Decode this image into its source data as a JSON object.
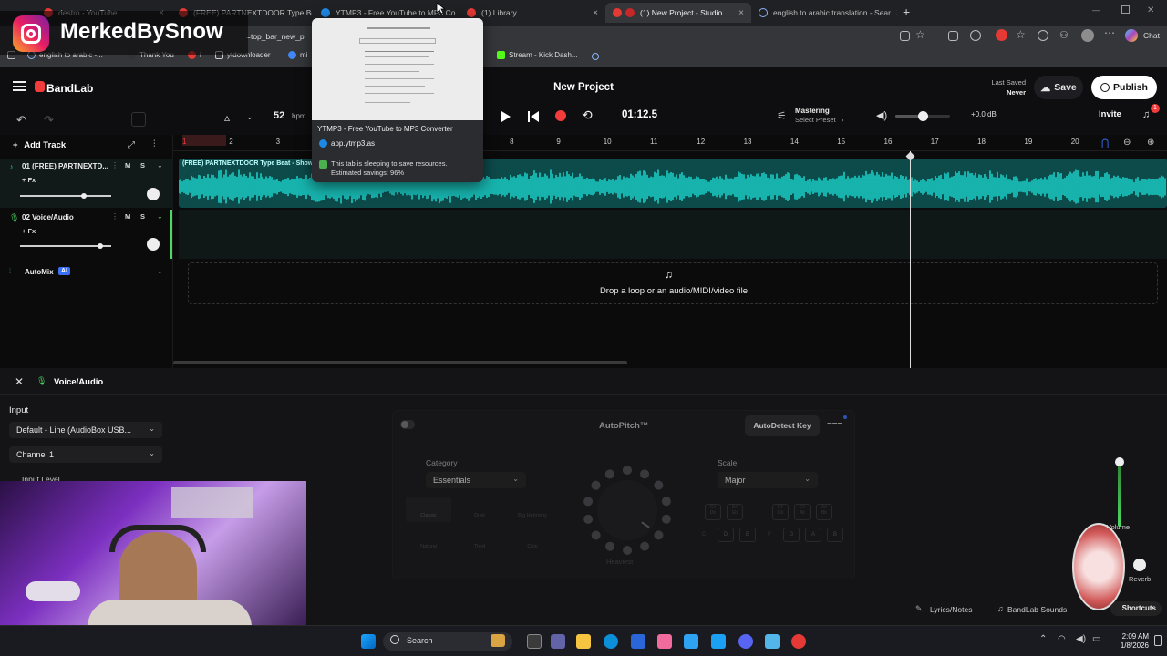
{
  "browser": {
    "tabs": [
      {
        "title": "destro - YouTube",
        "color": "#e53935"
      },
      {
        "title": "(FREE) PARTNEXTDOOR Type Beat",
        "color": "#e53935"
      },
      {
        "title": "YTMP3 - Free YouTube to MP3 Co",
        "color": "#1e88e5"
      },
      {
        "title": "(1) Library",
        "color": "#e53935"
      },
      {
        "title": "(1) New Project - Studio",
        "color": "#e53935"
      },
      {
        "title": "english to arabic translation - Sear",
        "color": "#8ab4f8"
      }
    ],
    "tab_close": "×",
    "new_tab": "+",
    "url": "=top_bar_new_p",
    "bookmarks": [
      "english to arabic -...",
      "Thank You",
      "i",
      "ytdownloader",
      "mi",
      "Stream - Kick Dash..."
    ],
    "chat_label": "Chat",
    "win_min": "—",
    "win_close": "✕"
  },
  "tab_preview": {
    "title": "YTMP3 - Free YouTube to MP3 Converter",
    "domain": "app.ytmp3.as",
    "sleep_line1": "This tab is sleeping to save resources.",
    "sleep_line2": "Estimated savings: 96%"
  },
  "watermark": {
    "name": "MerkedBySnow"
  },
  "app": {
    "brand": "BandLab",
    "project_title": "New Project",
    "last_saved_label": "Last Saved",
    "last_saved_value": "Never",
    "save_label": "Save",
    "publish_label": "Publish",
    "invite_label": "Invite",
    "notification_count": "1"
  },
  "transport": {
    "tempo": "52",
    "tempo_unit": "bpm",
    "time": "01:12.5",
    "mastering_label": "Mastering",
    "preset_label": "Select Preset",
    "preset_arrow": "›",
    "volume_db": "+0.0 dB",
    "volume_level": 0.5
  },
  "timeline": {
    "bars": [
      "1",
      "2",
      "3",
      "4",
      "5",
      "6",
      "7",
      "8",
      "9",
      "10",
      "11",
      "12",
      "13",
      "14",
      "15",
      "16",
      "17",
      "18",
      "19",
      "20"
    ],
    "playhead_bar": 16.55,
    "clip_label": "(FREE) PARTNEXTDOOR Type Beat - Show me",
    "drop_text": "Drop a loop or an audio/MIDI/video file"
  },
  "tracks": {
    "add_track_label": "Add Track",
    "items": [
      {
        "number": "01",
        "name": "(FREE) PARTNEXTD...",
        "fx": "+ Fx",
        "mute": "M",
        "solo": "S",
        "volume": 0.7
      },
      {
        "number": "02",
        "name": "Voice/Audio",
        "fx": "+ Fx",
        "mute": "M",
        "solo": "S",
        "volume": 0.88
      }
    ],
    "automix_label": "AutoMix",
    "ai_badge": "AI"
  },
  "panel": {
    "title": "Voice/Audio",
    "input_label": "Input",
    "input_device": "Default - Line (AudioBox USB...",
    "channel": "Channel 1",
    "input_level_label": "Input Level",
    "autopitch_label": "AutoPitch™",
    "autodetect_label": "AutoDetect Key",
    "category_label": "Category",
    "category_value": "Essentials",
    "scale_label": "Scale",
    "scale_value": "Major",
    "styles": [
      "Classic",
      "Duet",
      "Big Harmony",
      "Natural",
      "Third",
      "Chip"
    ],
    "knob_label": "Heaviest",
    "keys_top": [
      "C#\nDb",
      "D#\nEb",
      "F#\nGb",
      "G#\nAb",
      "A#\nBb"
    ],
    "keys_bottom": [
      "C",
      "D",
      "E",
      "F",
      "G",
      "A",
      "B"
    ],
    "volume_label": "Volume",
    "reverb_label": "Reverb",
    "lyrics_label": "Lyrics/Notes",
    "sounds_label": "BandLab Sounds",
    "shortcuts_label": "Shortcuts"
  },
  "taskbar": {
    "search_label": "Search",
    "time": "2:09 AM",
    "date": "1/8/2026"
  }
}
